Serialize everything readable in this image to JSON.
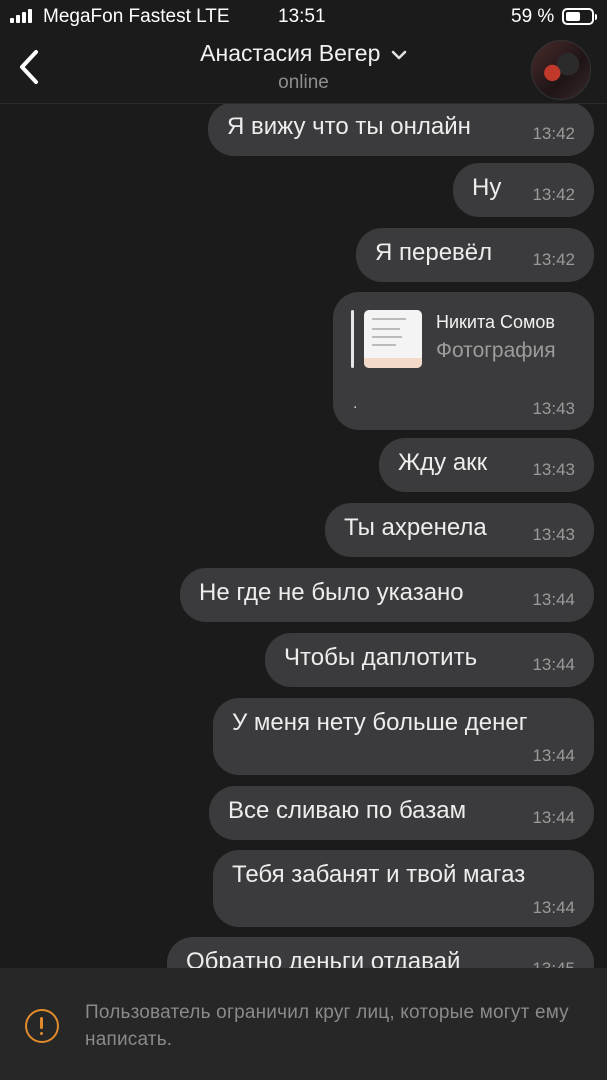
{
  "status_bar": {
    "carrier": "MegaFon Fastest LTE",
    "time": "13:51",
    "battery": "59 %"
  },
  "header": {
    "back_icon": "chevron-left-icon",
    "contact_name": "Анастасия Вегер",
    "status": "online"
  },
  "messages": [
    {
      "text": "Я вижу что ты онлайн",
      "time": "13:42"
    },
    {
      "text": "Ну",
      "time": "13:42"
    },
    {
      "text": "Я перевёл",
      "time": "13:42"
    },
    {
      "type": "shared_post",
      "author": "Никита Сомов",
      "kind": "Фотография",
      "caption": ".",
      "time": "13:43"
    },
    {
      "text": "Жду акк",
      "time": "13:43"
    },
    {
      "text": "Ты ахренела",
      "time": "13:43"
    },
    {
      "text": "Не где не было указано",
      "time": "13:44"
    },
    {
      "text": "Чтобы даплотить",
      "time": "13:44"
    },
    {
      "text": "У меня нету больше денег",
      "time": "13:44"
    },
    {
      "text": "Все сливаю по базам",
      "time": "13:44"
    },
    {
      "text": "Тебя забанят и твой магаз",
      "time": "13:44"
    },
    {
      "text": "Обратно деньги отдавай",
      "time": "13:45"
    }
  ],
  "notice": {
    "icon": "warning-icon",
    "color": "#e08a2b",
    "text": "Пользователь ограничил круг лиц, которые могут ему написать."
  }
}
